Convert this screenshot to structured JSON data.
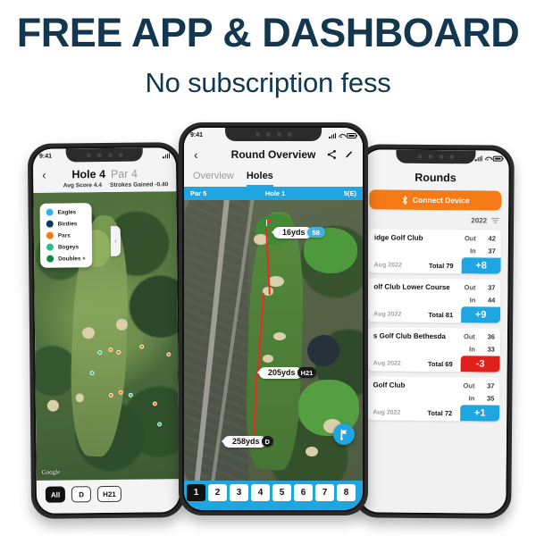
{
  "headline": {
    "title": "FREE APP & DASHBOARD",
    "subtitle": "No subscription fess",
    "color": "#12374f"
  },
  "phone_left": {
    "status": {
      "time": "9:41"
    },
    "navbar": {
      "back_icon": "chevron-left-icon",
      "hole": "Hole 4",
      "par": "Par 4",
      "avg_score": "Avg Score 4.4",
      "strokes_gained": "Strokes Gained -0.40"
    },
    "legend": {
      "items": [
        {
          "label": "Eagles",
          "color": "#35b4e8"
        },
        {
          "label": "Birdies",
          "color": "#0d3a5c"
        },
        {
          "label": "Pars",
          "color": "#f47b16"
        },
        {
          "label": "Bogeys",
          "color": "#28c08a"
        },
        {
          "label": "Doubles +",
          "color": "#0f8a4a"
        }
      ],
      "collapse_icon": "chevron-left-icon"
    },
    "map": {
      "watermark": "Google"
    },
    "chips": [
      {
        "label": "All",
        "selected": true
      },
      {
        "label": "D",
        "selected": false
      },
      {
        "label": "H21",
        "selected": false
      }
    ]
  },
  "phone_center": {
    "status": {
      "time": "9:41"
    },
    "navbar": {
      "back_icon": "chevron-left-icon",
      "title": "Round Overview",
      "share_icon": "share-icon",
      "edit_icon": "pencil-icon"
    },
    "tabs": [
      {
        "label": "Overview",
        "active": false
      },
      {
        "label": "Holes",
        "active": true
      }
    ],
    "par_bar": {
      "par": "Par 5",
      "hole": "Hole 1",
      "score": "5(E)"
    },
    "markers": [
      {
        "distance": "16yds",
        "club": "58",
        "badge_color": "#3fb0e8"
      },
      {
        "distance": "205yds",
        "club": "H21",
        "badge_color": "#1a1a1a"
      },
      {
        "distance": "258yds",
        "club": "D",
        "badge_color": "#1a1a1a"
      }
    ],
    "fab_icon": "flag-icon",
    "hole_selector": [
      {
        "label": "1",
        "selected": true
      },
      {
        "label": "2",
        "selected": false
      },
      {
        "label": "3",
        "selected": false
      },
      {
        "label": "4",
        "selected": false
      },
      {
        "label": "5",
        "selected": false
      },
      {
        "label": "6",
        "selected": false
      },
      {
        "label": "7",
        "selected": false
      },
      {
        "label": "8",
        "selected": false
      }
    ]
  },
  "phone_right": {
    "title": "Rounds",
    "connect_button": {
      "label": "Connect Device",
      "icon": "bluetooth-icon",
      "color": "#f47b16"
    },
    "filter": {
      "year": "2022",
      "icon": "filter-icon"
    },
    "rounds": [
      {
        "course": "idge Golf Club",
        "out_label": "Out",
        "out": "42",
        "in_label": "In",
        "in": "37",
        "date": "Aug 2022",
        "total_label": "Total 79",
        "score": "+8",
        "score_color": "#1fa5e0"
      },
      {
        "course": "olf Club Lower Course",
        "out_label": "Out",
        "out": "37",
        "in_label": "In",
        "in": "44",
        "date": "Aug 2022",
        "total_label": "Total 81",
        "score": "+9",
        "score_color": "#1fa5e0"
      },
      {
        "course": "s Golf Club Bethesda",
        "out_label": "Out",
        "out": "36",
        "in_label": "In",
        "in": "33",
        "date": "Aug 2022",
        "total_label": "Total 69",
        "score": "-3",
        "score_color": "#e0201b"
      },
      {
        "course": "Golf Club",
        "out_label": "Out",
        "out": "37",
        "in_label": "In",
        "in": "35",
        "date": "Aug 2022",
        "total_label": "Total 72",
        "score": "+1",
        "score_color": "#1fa5e0"
      }
    ]
  }
}
